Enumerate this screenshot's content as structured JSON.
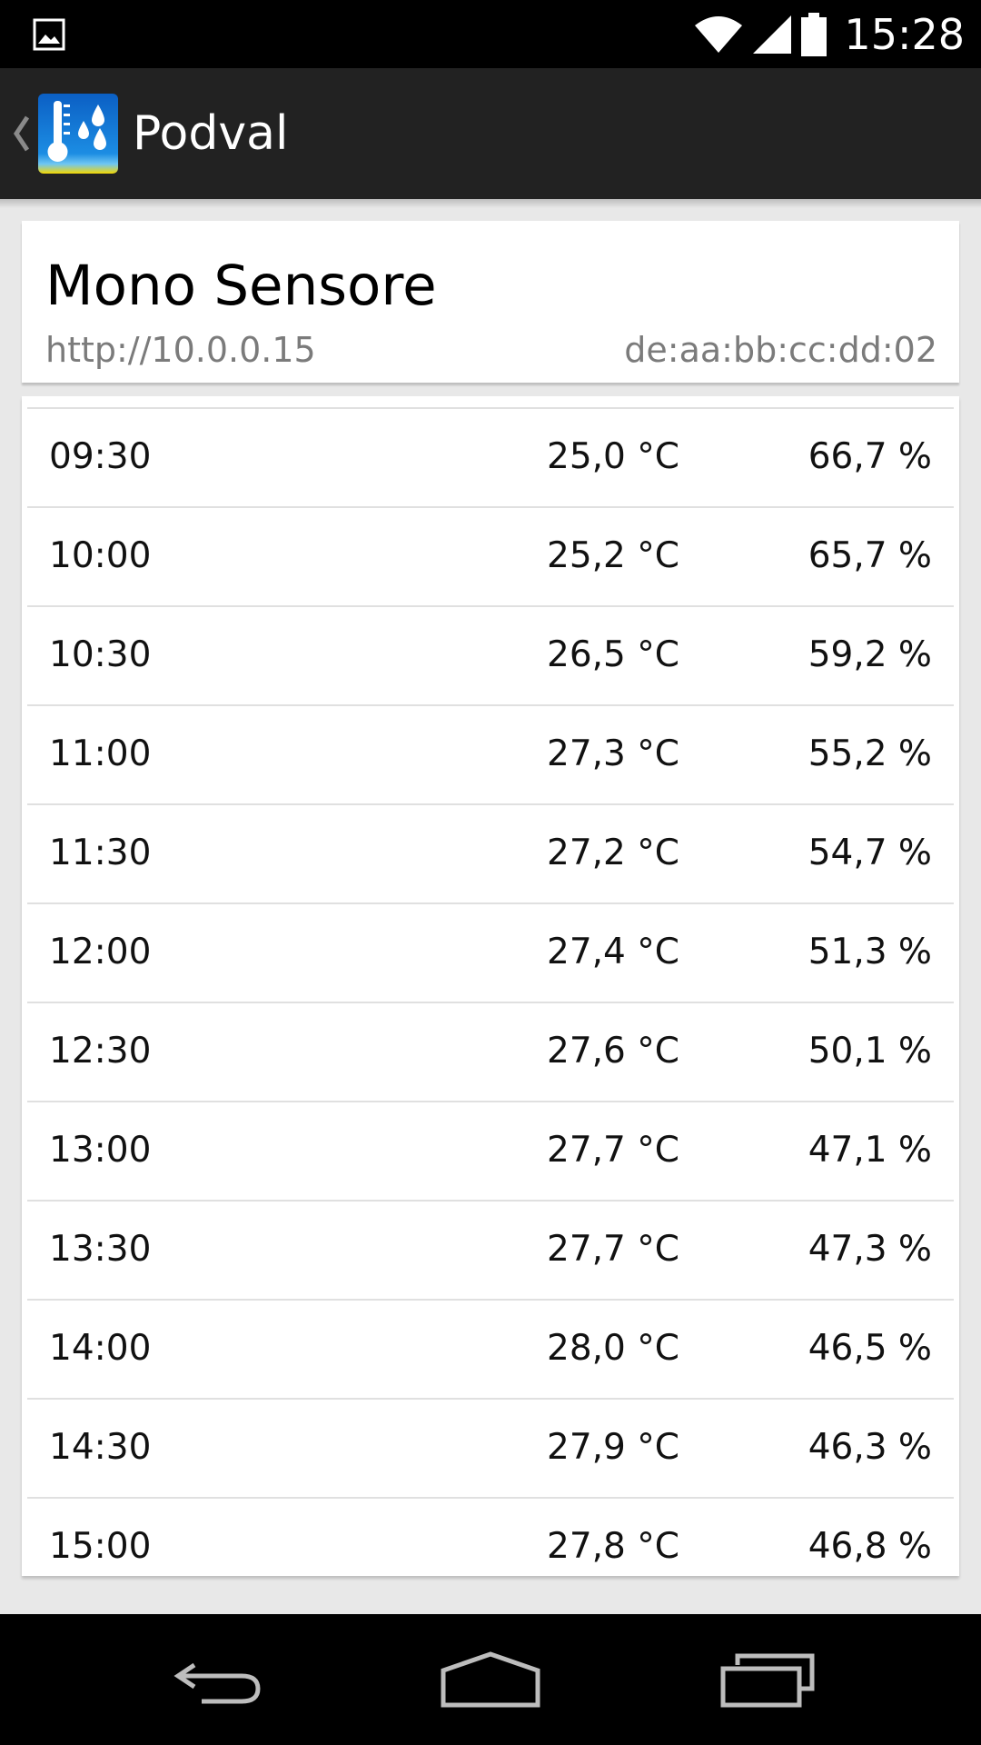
{
  "status_bar": {
    "time": "15:28",
    "icons": [
      "image-notification-icon",
      "wifi-icon",
      "signal-icon",
      "battery-icon"
    ]
  },
  "action_bar": {
    "title": "Podval",
    "app_icon": "thermometer-droplets-icon",
    "colors": {
      "background": "#222222",
      "icon_blue": "#1a7fd6",
      "icon_yellow": "#f5d800"
    }
  },
  "sensor": {
    "name": "Mono Sensore",
    "url": "http://10.0.0.15",
    "mac": "de:aa:bb:cc:dd:02"
  },
  "readings": [
    {
      "time": "09:30",
      "temp": "25,0 °C",
      "humidity": "66,7 %"
    },
    {
      "time": "10:00",
      "temp": "25,2 °C",
      "humidity": "65,7 %"
    },
    {
      "time": "10:30",
      "temp": "26,5 °C",
      "humidity": "59,2 %"
    },
    {
      "time": "11:00",
      "temp": "27,3 °C",
      "humidity": "55,2 %"
    },
    {
      "time": "11:30",
      "temp": "27,2 °C",
      "humidity": "54,7 %"
    },
    {
      "time": "12:00",
      "temp": "27,4 °C",
      "humidity": "51,3 %"
    },
    {
      "time": "12:30",
      "temp": "27,6 °C",
      "humidity": "50,1 %"
    },
    {
      "time": "13:00",
      "temp": "27,7 °C",
      "humidity": "47,1 %"
    },
    {
      "time": "13:30",
      "temp": "27,7 °C",
      "humidity": "47,3 %"
    },
    {
      "time": "14:00",
      "temp": "28,0 °C",
      "humidity": "46,5 %"
    },
    {
      "time": "14:30",
      "temp": "27,9 °C",
      "humidity": "46,3 %"
    },
    {
      "time": "15:00",
      "temp": "27,8 °C",
      "humidity": "46,8 %"
    }
  ],
  "nav_bar": {
    "buttons": [
      "back-icon",
      "home-icon",
      "recents-icon"
    ]
  }
}
